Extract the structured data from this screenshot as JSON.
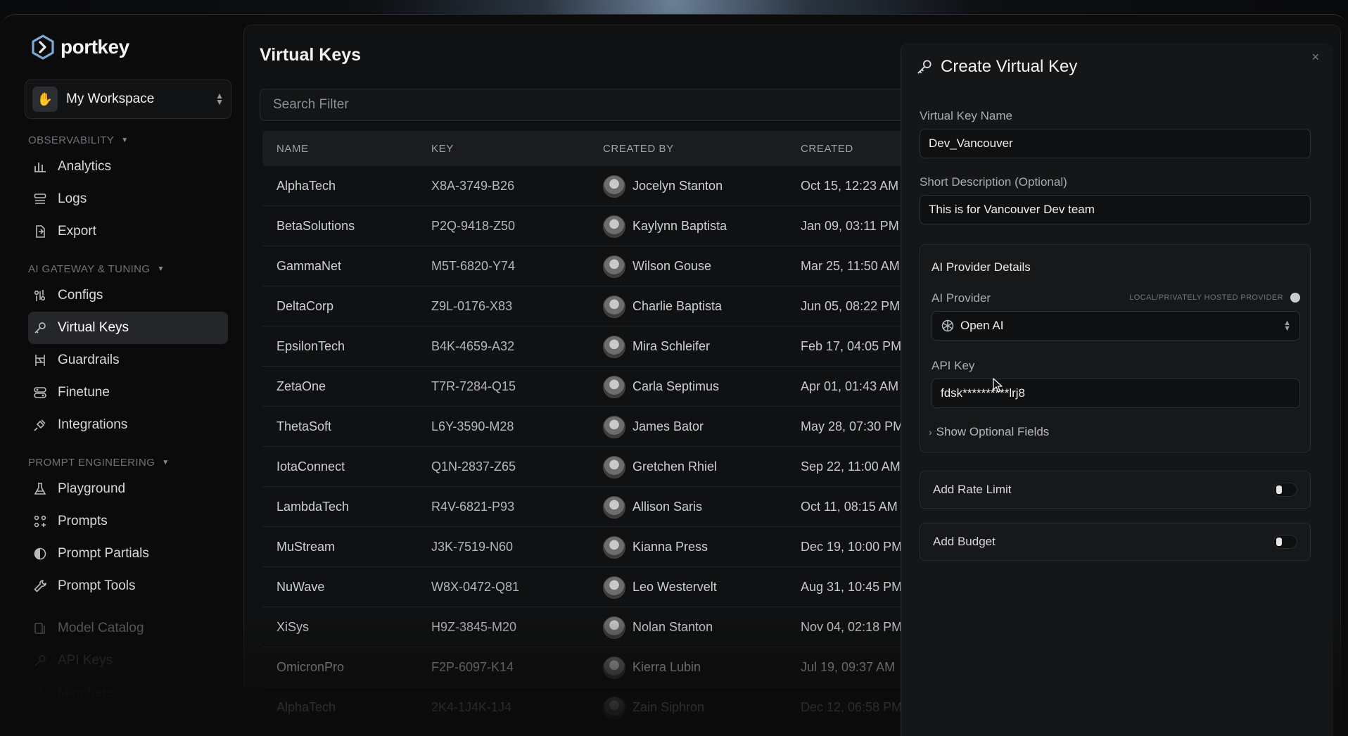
{
  "brand": {
    "name": "portkey"
  },
  "workspace": {
    "name": "My Workspace"
  },
  "sidebar": {
    "sections": [
      {
        "label": "OBSERVABILITY",
        "items": [
          {
            "label": "Analytics",
            "icon": "bar-chart-icon"
          },
          {
            "label": "Logs",
            "icon": "list-icon"
          },
          {
            "label": "Export",
            "icon": "file-export-icon"
          }
        ]
      },
      {
        "label": "AI GATEWAY & TUNING",
        "items": [
          {
            "label": "Configs",
            "icon": "sliders-icon"
          },
          {
            "label": "Virtual Keys",
            "icon": "key-icon",
            "active": true
          },
          {
            "label": "Guardrails",
            "icon": "guardrail-icon"
          },
          {
            "label": "Finetune",
            "icon": "finetune-icon"
          },
          {
            "label": "Integrations",
            "icon": "plug-icon"
          }
        ]
      },
      {
        "label": "PROMPT ENGINEERING",
        "items": [
          {
            "label": "Playground",
            "icon": "flask-icon"
          },
          {
            "label": "Prompts",
            "icon": "nodes-icon"
          },
          {
            "label": "Prompt Partials",
            "icon": "half-circle-icon"
          },
          {
            "label": "Prompt Tools",
            "icon": "wrench-icon"
          }
        ]
      }
    ],
    "footer_items": [
      {
        "label": "Model Catalog",
        "icon": "catalog-icon"
      },
      {
        "label": "API Keys",
        "icon": "key-icon"
      },
      {
        "label": "Members",
        "icon": "users-icon"
      }
    ]
  },
  "main": {
    "title": "Virtual Keys",
    "search_placeholder": "Search Filter",
    "columns": [
      "NAME",
      "KEY",
      "CREATED BY",
      "CREATED"
    ],
    "rows": [
      {
        "name": "AlphaTech",
        "key": "X8A-3749-B26",
        "by": "Jocelyn Stanton",
        "created": "Oct 15, 12:23 AM"
      },
      {
        "name": "BetaSolutions",
        "key": "P2Q-9418-Z50",
        "by": "Kaylynn Baptista",
        "created": "Jan 09, 03:11 PM"
      },
      {
        "name": "GammaNet",
        "key": "M5T-6820-Y74",
        "by": "Wilson Gouse",
        "created": "Mar 25, 11:50 AM"
      },
      {
        "name": "DeltaCorp",
        "key": "Z9L-0176-X83",
        "by": "Charlie Baptista",
        "created": "Jun 05, 08:22 PM"
      },
      {
        "name": "EpsilonTech",
        "key": "B4K-4659-A32",
        "by": "Mira Schleifer",
        "created": "Feb 17, 04:05 PM"
      },
      {
        "name": "ZetaOne",
        "key": "T7R-7284-Q15",
        "by": "Carla Septimus",
        "created": "Apr 01, 01:43 AM"
      },
      {
        "name": "ThetaSoft",
        "key": "L6Y-3590-M28",
        "by": "James Bator",
        "created": "May 28, 07:30 PM"
      },
      {
        "name": "IotaConnect",
        "key": "Q1N-2837-Z65",
        "by": "Gretchen Rhiel",
        "created": "Sep 22, 11:00 AM"
      },
      {
        "name": "LambdaTech",
        "key": "R4V-6821-P93",
        "by": "Allison Saris",
        "created": "Oct 11, 08:15 AM"
      },
      {
        "name": "MuStream",
        "key": "J3K-7519-N60",
        "by": "Kianna Press",
        "created": "Dec 19, 10:00 PM"
      },
      {
        "name": "NuWave",
        "key": "W8X-0472-Q81",
        "by": "Leo Westervelt",
        "created": "Aug 31, 10:45 PM"
      },
      {
        "name": "XiSys",
        "key": "H9Z-3845-M20",
        "by": "Nolan Stanton",
        "created": "Nov 04, 02:18 PM"
      },
      {
        "name": "OmicronPro",
        "key": "F2P-6097-K14",
        "by": "Kierra Lubin",
        "created": "Jul 19, 09:37 AM"
      },
      {
        "name": "AlphaTech",
        "key": "2K4-1J4K-1J4",
        "by": "Zain Siphron",
        "created": "Dec 12, 06:58 PM"
      }
    ]
  },
  "drawer": {
    "title": "Create Virtual Key",
    "close": "×",
    "name_label": "Virtual Key Name",
    "name_value": "Dev_Vancouver",
    "desc_label": "Short Description (Optional)",
    "desc_value": "This is for Vancouver Dev team",
    "provider_section_title": "AI Provider Details",
    "provider_label": "AI Provider",
    "local_label": "LOCAL/PRIVATELY HOSTED PROVIDER",
    "provider_value": "Open AI",
    "api_key_label": "API Key",
    "api_key_value": "fdsk**********lrj8",
    "optional_fields": "Show Optional Fields",
    "rate_limit": "Add Rate Limit",
    "budget": "Add Budget"
  }
}
